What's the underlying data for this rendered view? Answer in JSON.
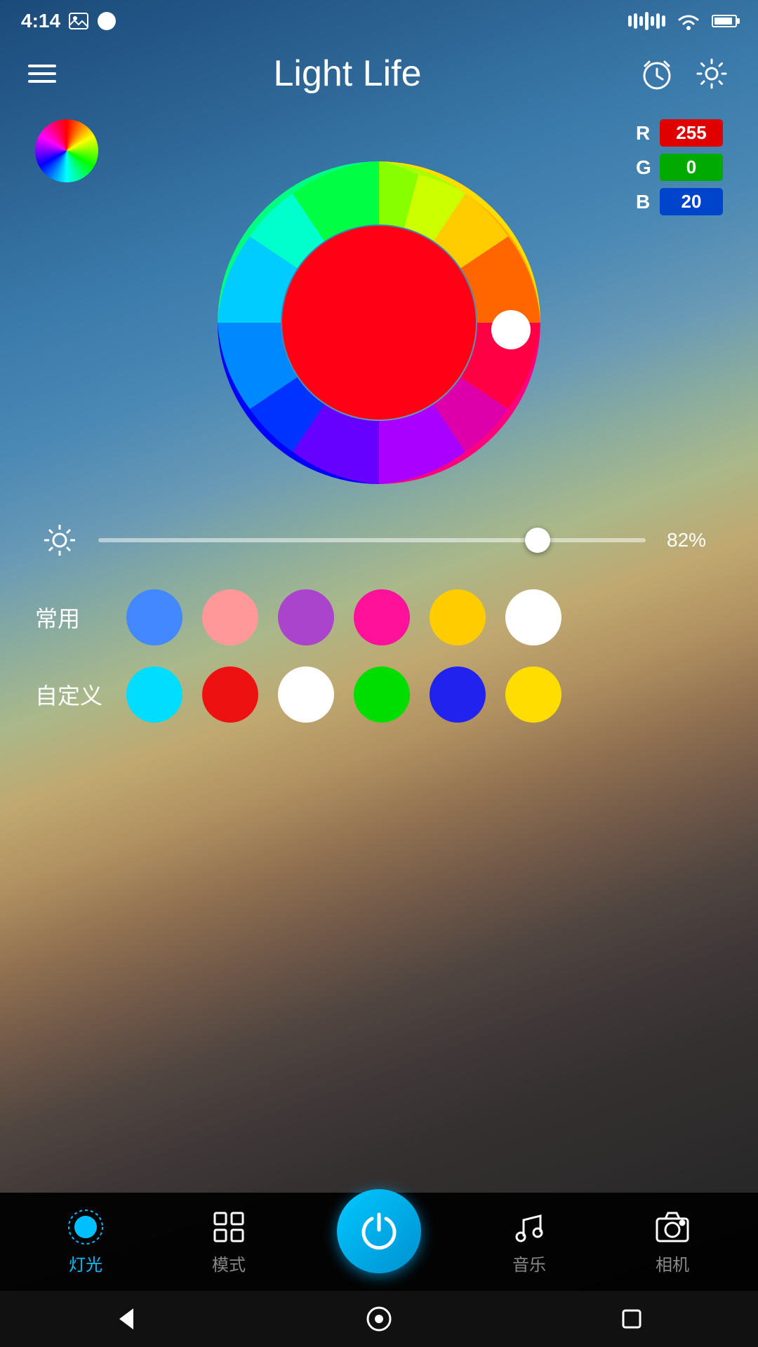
{
  "statusBar": {
    "time": "4:14",
    "batteryLevel": 90
  },
  "header": {
    "title": "Light Life",
    "menuIcon": "menu",
    "alarmIcon": "alarm-clock",
    "settingsIcon": "settings-gear"
  },
  "colorPicker": {
    "rgb": {
      "r_label": "R",
      "g_label": "G",
      "b_label": "B",
      "r_value": "255",
      "g_value": "0",
      "b_value": "20"
    },
    "selectedColor": "#ff0014"
  },
  "brightness": {
    "value": 82,
    "label": "82%"
  },
  "presets": {
    "common_label": "常用",
    "custom_label": "自定义",
    "common_colors": [
      {
        "color": "#4488ff",
        "name": "blue"
      },
      {
        "color": "#ff9999",
        "name": "pink"
      },
      {
        "color": "#aa44cc",
        "name": "purple"
      },
      {
        "color": "#ff1199",
        "name": "magenta"
      },
      {
        "color": "#ffcc00",
        "name": "yellow"
      },
      {
        "color": "#ffffff",
        "name": "white"
      }
    ],
    "custom_colors": [
      {
        "color": "#00ddff",
        "name": "cyan"
      },
      {
        "color": "#ee1111",
        "name": "red"
      },
      {
        "color": "#ffffff",
        "name": "white"
      },
      {
        "color": "#00dd00",
        "name": "green"
      },
      {
        "color": "#2222ee",
        "name": "blue"
      },
      {
        "color": "#ffdd00",
        "name": "yellow"
      }
    ]
  },
  "bottomNav": {
    "items": [
      {
        "id": "lights",
        "label": "灯光",
        "icon": "light-bulb",
        "active": true
      },
      {
        "id": "modes",
        "label": "模式",
        "icon": "grid-icon",
        "active": false
      },
      {
        "id": "power",
        "label": "",
        "icon": "power-icon",
        "active": false
      },
      {
        "id": "music",
        "label": "音乐",
        "icon": "music-note",
        "active": false
      },
      {
        "id": "camera",
        "label": "相机",
        "icon": "camera-icon",
        "active": false
      }
    ]
  },
  "sysNav": {
    "back": "back-arrow",
    "home": "home-circle",
    "recent": "recent-square"
  }
}
